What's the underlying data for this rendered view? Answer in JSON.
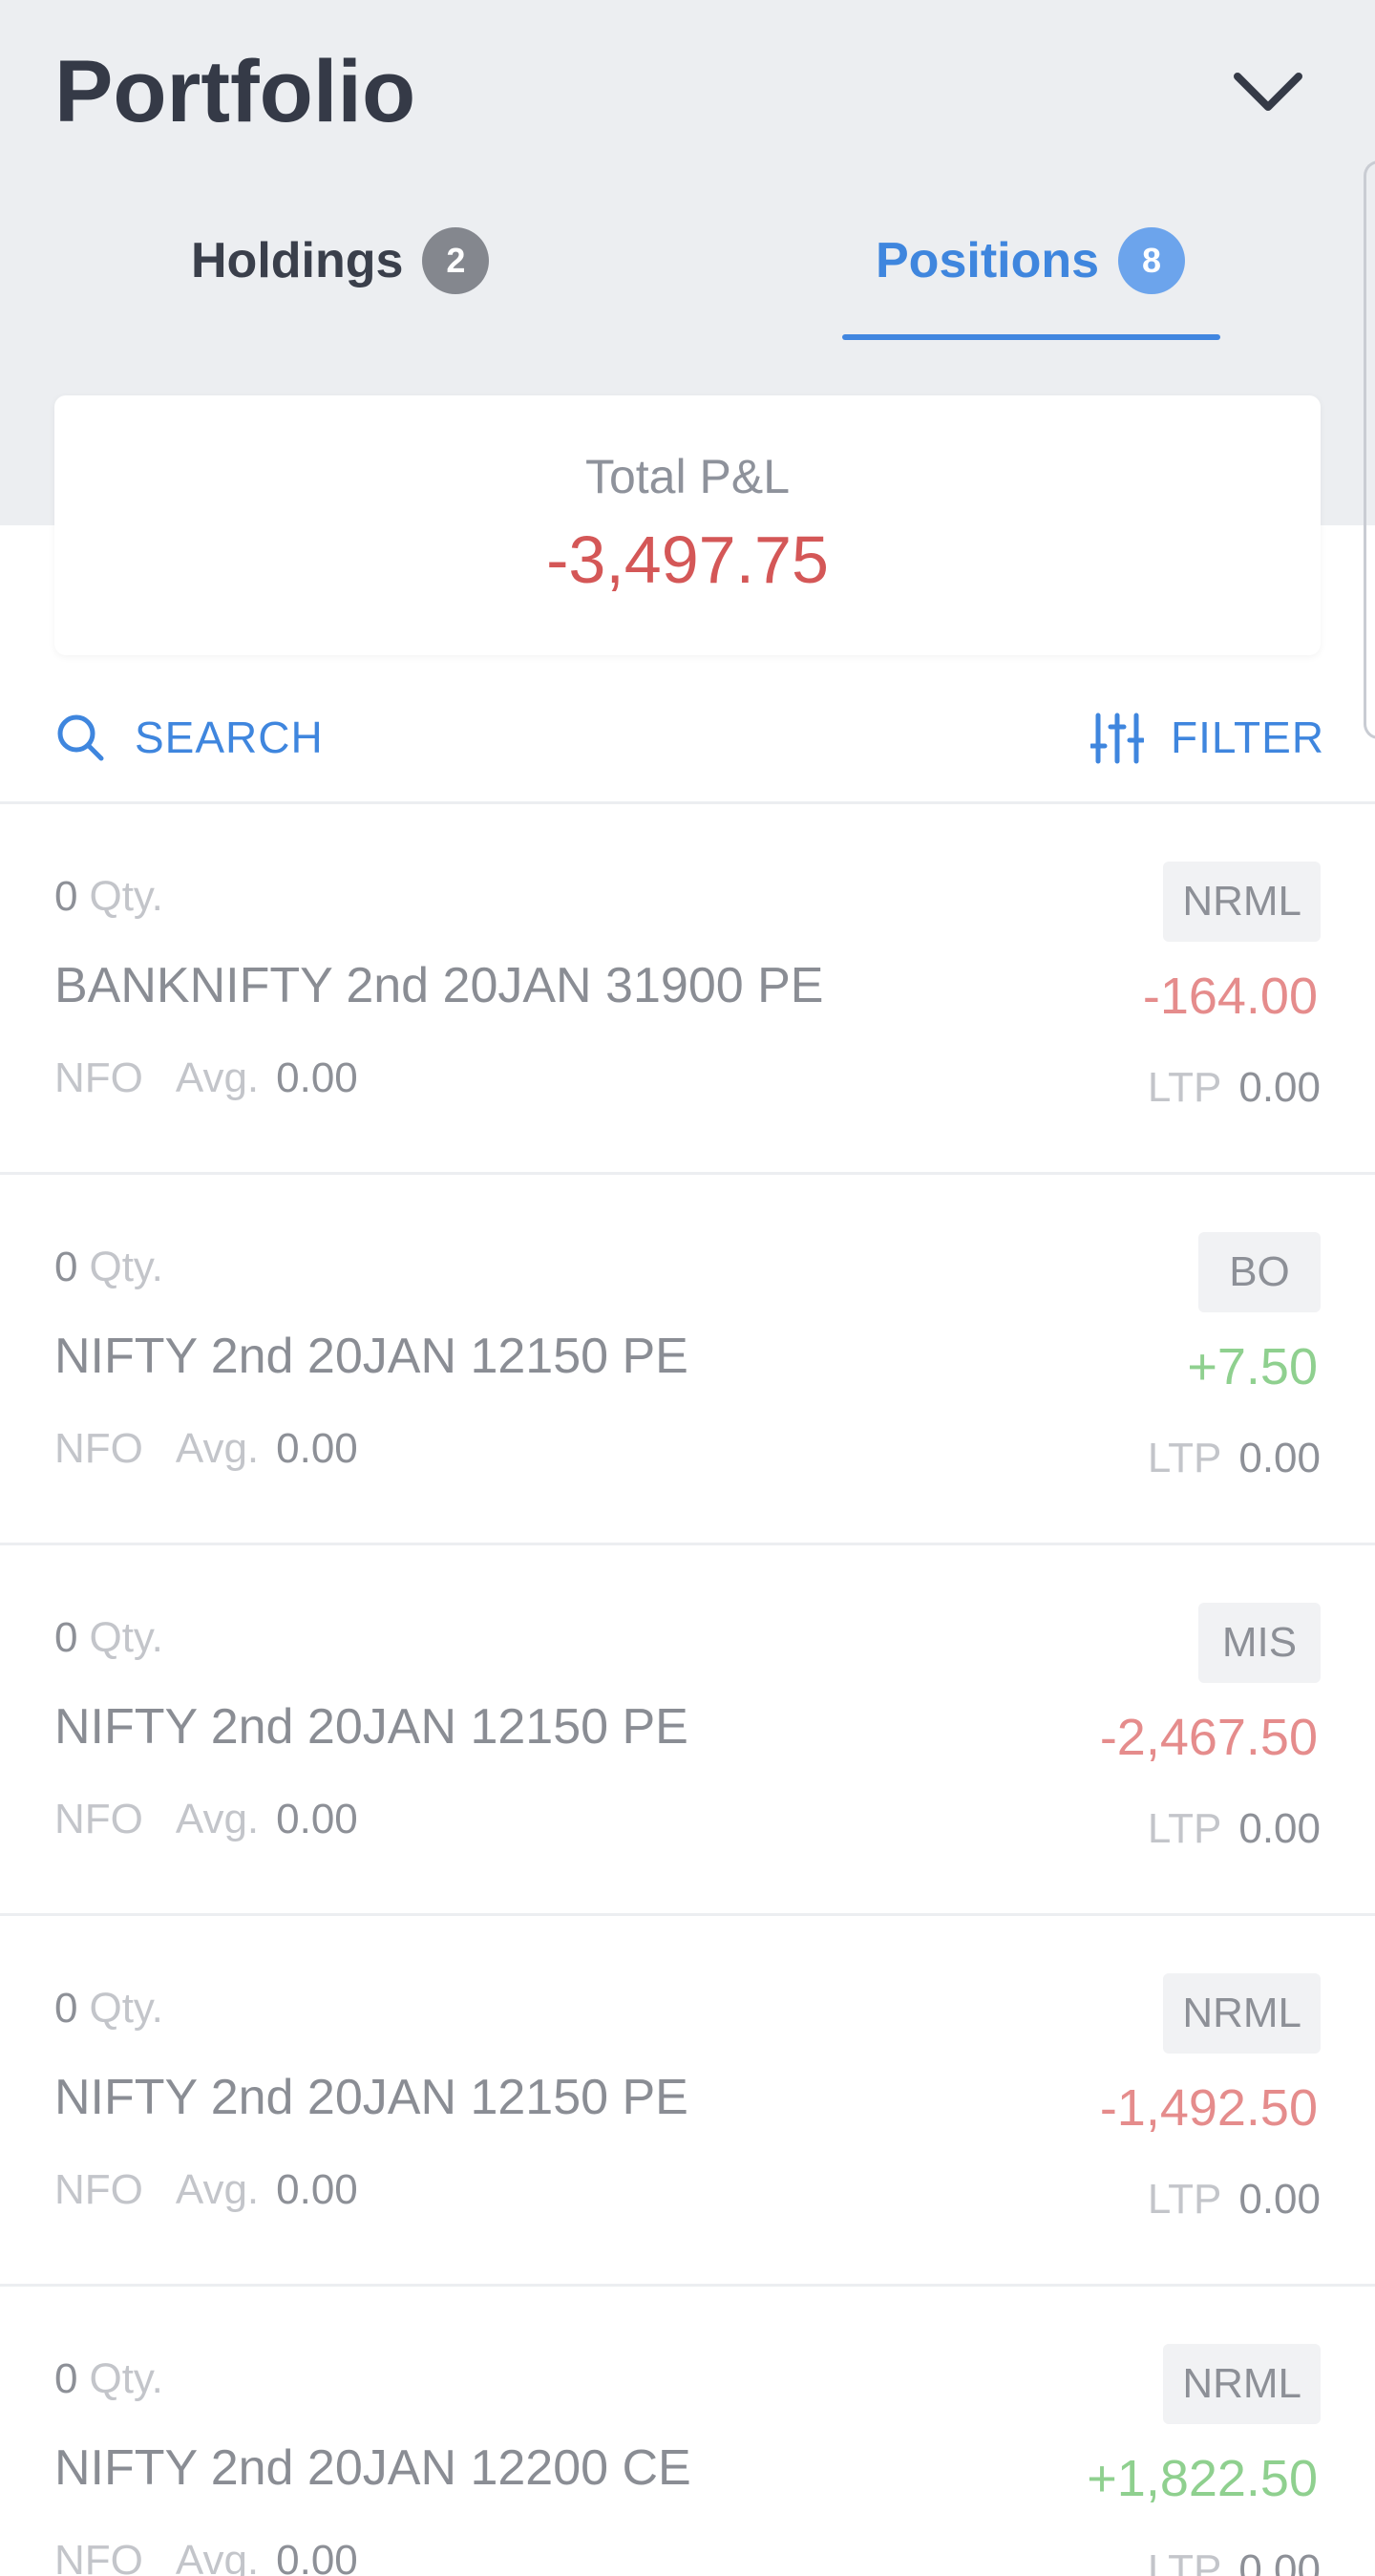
{
  "header": {
    "title": "Portfolio"
  },
  "tabs": [
    {
      "label": "Holdings",
      "count": "2",
      "active": false
    },
    {
      "label": "Positions",
      "count": "8",
      "active": true
    }
  ],
  "summary": {
    "label": "Total P&L",
    "value": "-3,497.75"
  },
  "toolbar": {
    "search_label": "SEARCH",
    "filter_label": "FILTER"
  },
  "positions": [
    {
      "qty": "0",
      "qty_unit": "Qty.",
      "symbol": "BANKNIFTY 2nd 20JAN 31900 PE",
      "exchange": "NFO",
      "avg_label": "Avg.",
      "avg": "0.00",
      "product": "NRML",
      "pnl": "-164.00",
      "pnl_sign": "neg",
      "ltp_label": "LTP",
      "ltp": "0.00"
    },
    {
      "qty": "0",
      "qty_unit": "Qty.",
      "symbol": "NIFTY 2nd 20JAN 12150 PE",
      "exchange": "NFO",
      "avg_label": "Avg.",
      "avg": "0.00",
      "product": "BO",
      "pnl": "+7.50",
      "pnl_sign": "pos",
      "ltp_label": "LTP",
      "ltp": "0.00"
    },
    {
      "qty": "0",
      "qty_unit": "Qty.",
      "symbol": "NIFTY 2nd 20JAN 12150 PE",
      "exchange": "NFO",
      "avg_label": "Avg.",
      "avg": "0.00",
      "product": "MIS",
      "pnl": "-2,467.50",
      "pnl_sign": "neg",
      "ltp_label": "LTP",
      "ltp": "0.00"
    },
    {
      "qty": "0",
      "qty_unit": "Qty.",
      "symbol": "NIFTY 2nd 20JAN 12150 PE",
      "exchange": "NFO",
      "avg_label": "Avg.",
      "avg": "0.00",
      "product": "NRML",
      "pnl": "-1,492.50",
      "pnl_sign": "neg",
      "ltp_label": "LTP",
      "ltp": "0.00"
    },
    {
      "qty": "0",
      "qty_unit": "Qty.",
      "symbol": "NIFTY 2nd 20JAN 12200 CE",
      "exchange": "NFO",
      "avg_label": "Avg.",
      "avg": "0.00",
      "product": "NRML",
      "pnl": "+1,822.50",
      "pnl_sign": "pos",
      "ltp_label": "LTP",
      "ltp": "0.00"
    }
  ],
  "colors": {
    "accent": "#3f86de",
    "loss": "#d45757",
    "loss_light": "#e58c8c",
    "profit_light": "#8fd08f",
    "header_bg": "#eceef1"
  },
  "icons": {
    "collapse": "chevron-down-icon",
    "search": "search-icon",
    "filter": "sliders-icon"
  }
}
